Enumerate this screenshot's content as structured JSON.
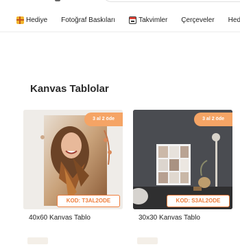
{
  "nav": {
    "items": [
      {
        "label": "Hediye",
        "icon": "gift-icon"
      },
      {
        "label": "Fotoğraf Baskıları",
        "icon": null
      },
      {
        "label": "Takvimler",
        "icon": "calendar-icon"
      },
      {
        "label": "Çerçeveler",
        "icon": null
      },
      {
        "label": "Hedi",
        "icon": null
      }
    ]
  },
  "section": {
    "title": "Kanvas Tablolar"
  },
  "products": [
    {
      "badge": "3 al 2 öde",
      "code": "KOD: T3AL2ODE",
      "title": "40x60 Kanvas Tablo"
    },
    {
      "badge": "3 al 2 öde",
      "code": "KOD: S3AL2ODE",
      "title": "30x30 Kanvas Tablo"
    }
  ],
  "colors": {
    "accent": "#ef7d3b",
    "badge": "#f5a465"
  }
}
